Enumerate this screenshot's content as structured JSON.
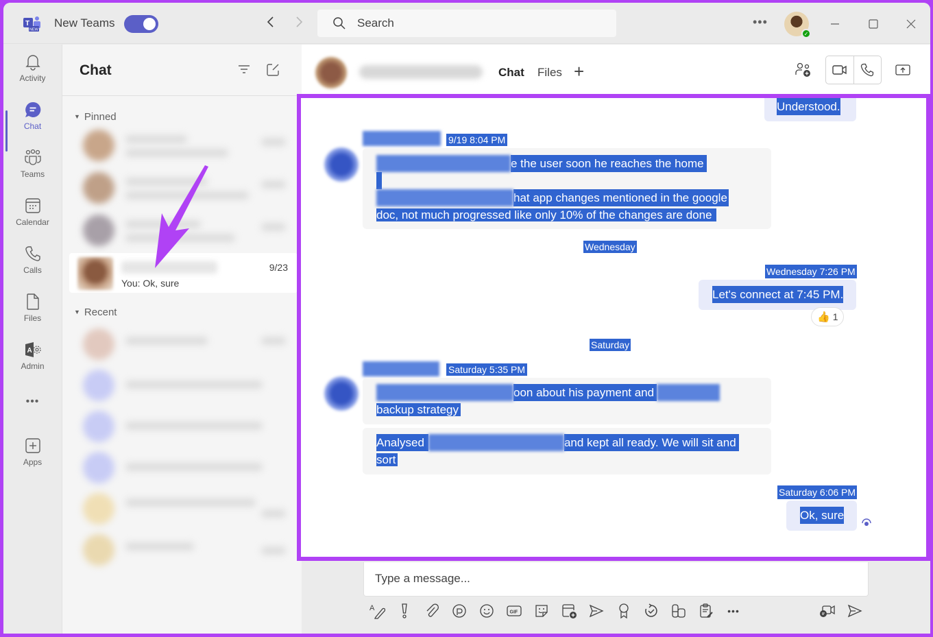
{
  "app": {
    "name": "New Teams",
    "new_teams_enabled": true
  },
  "titlebar": {
    "search_placeholder": "Search",
    "more": "•••",
    "profile_status": "available"
  },
  "rail": {
    "items": [
      {
        "label": "Activity",
        "icon": "bell-icon"
      },
      {
        "label": "Chat",
        "icon": "chat-icon",
        "active": true
      },
      {
        "label": "Teams",
        "icon": "teams-icon"
      },
      {
        "label": "Calendar",
        "icon": "calendar-icon"
      },
      {
        "label": "Calls",
        "icon": "phone-icon"
      },
      {
        "label": "Files",
        "icon": "file-icon"
      },
      {
        "label": "Admin",
        "icon": "admin-icon"
      },
      {
        "label": "",
        "icon": "more-icon"
      },
      {
        "label": "Apps",
        "icon": "apps-icon"
      }
    ],
    "more_glyph": "•••"
  },
  "chatlist": {
    "title": "Chat",
    "pinned_label": "Pinned",
    "recent_label": "Recent",
    "selected_chat": {
      "preview": "You: Ok, sure",
      "date": "9/23"
    }
  },
  "conversation": {
    "tabs": [
      {
        "label": "Chat",
        "active": true
      },
      {
        "label": "Files",
        "active": false
      }
    ],
    "add_tab": "+",
    "messages": {
      "m0": {
        "text": "Understood."
      },
      "m1": {
        "timestamp": "9/19 8:04 PM",
        "line1": "e the user soon he reaches the home",
        "line3": "hat app changes mentioned in the google",
        "line4": "doc, not much progressed like only 10% of the changes are done"
      },
      "sep1": "Wednesday",
      "m2": {
        "timestamp": "Wednesday 7:26 PM",
        "text": "Let's connect at 7:45 PM.",
        "reaction_emoji": "👍",
        "reaction_count": "1"
      },
      "sep2": "Saturday",
      "m3": {
        "timestamp": "Saturday 5:35 PM",
        "line1": "oon about his payment and",
        "line2": "backup strategy",
        "line3a": "Analysed",
        "line3b": "and kept all ready. We will sit and",
        "line4": "sort"
      },
      "m4": {
        "timestamp": "Saturday 6:06 PM",
        "text": "Ok, sure"
      }
    }
  },
  "compose": {
    "placeholder": "Type a message...",
    "tools": [
      "format-icon",
      "important-icon",
      "attach-icon",
      "loop-icon",
      "emoji-icon",
      "gif-icon",
      "sticker-icon",
      "schedule-meeting-icon",
      "stream-icon",
      "praise-icon",
      "updates-icon",
      "apps-icon",
      "approvals-icon",
      "more-icon"
    ],
    "more_glyph": "•••",
    "gif_label": "GIF"
  },
  "colors": {
    "accent": "#5b5fc7",
    "highlight_border": "#b042f5",
    "selection": "#3064d0",
    "presence_available": "#13a10e"
  }
}
